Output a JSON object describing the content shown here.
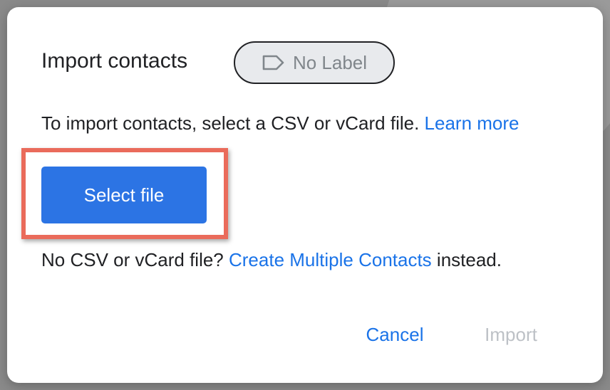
{
  "dialog": {
    "title": "Import contacts",
    "label_chip": {
      "text": "No Label",
      "icon": "label-outline-icon"
    },
    "description": {
      "text": "To import contacts, select a CSV or vCard file.",
      "link": "Learn more"
    },
    "select_file_label": "Select file",
    "alternative": {
      "prefix": "No CSV or vCard file?",
      "link": "Create Multiple Contacts",
      "suffix": "instead."
    },
    "actions": {
      "cancel_label": "Cancel",
      "import_label": "Import",
      "import_disabled": true
    }
  },
  "colors": {
    "primary_button": "#2c74e4",
    "link": "#1a73e8",
    "highlight_border": "#ea6b5b",
    "disabled_text": "#bdc1c6",
    "chip_background": "#e8eaed"
  }
}
